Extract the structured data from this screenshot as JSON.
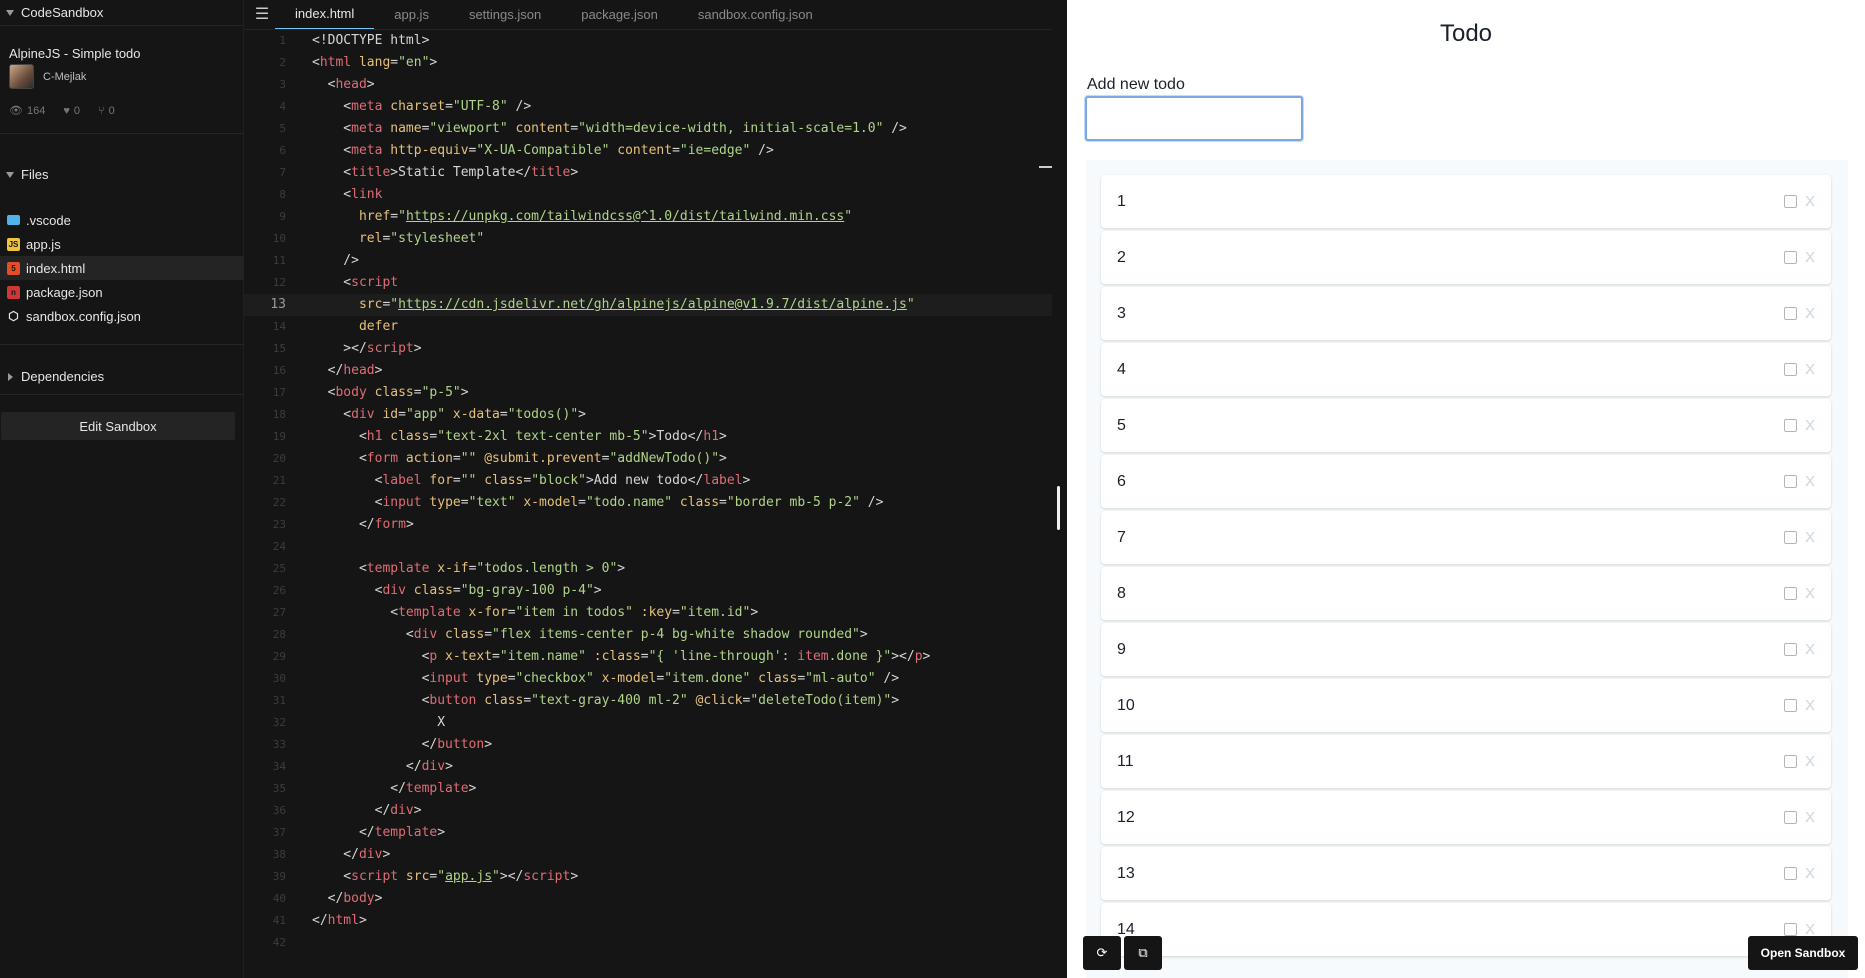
{
  "app_name": "CodeSandbox",
  "project": {
    "title": "AlpineJS - Simple todo",
    "author": "C-Mejlak",
    "views": "164",
    "likes": "0",
    "forks": "0"
  },
  "files_section": "Files",
  "files": [
    {
      "name": ".vscode",
      "icon": "folder-icon",
      "color": "#4fb3e8"
    },
    {
      "name": "app.js",
      "icon": "javascript-icon",
      "color": "#f0c33c"
    },
    {
      "name": "index.html",
      "icon": "html-icon",
      "color": "#e44d26",
      "active": true
    },
    {
      "name": "package.json",
      "icon": "npm-icon",
      "color": "#cb3837"
    },
    {
      "name": "sandbox.config.json",
      "icon": "codesandbox-cube-icon",
      "color": "#e6e6e6"
    }
  ],
  "dependencies_section": "Dependencies",
  "edit_sandbox": "Edit Sandbox",
  "tabs": [
    "index.html",
    "app.js",
    "settings.json",
    "package.json",
    "sandbox.config.json"
  ],
  "active_tab": "index.html",
  "current_line": 13,
  "code_lines": [
    [
      [
        "p",
        "<!DOCTYPE html>"
      ]
    ],
    [
      [
        "p",
        "<"
      ],
      [
        "t",
        "html"
      ],
      [
        "a",
        " lang"
      ],
      [
        "p",
        "="
      ],
      [
        "s",
        "\"en\""
      ],
      [
        "p",
        ">"
      ]
    ],
    [
      [
        "p",
        "  <"
      ],
      [
        "t",
        "head"
      ],
      [
        "p",
        ">"
      ]
    ],
    [
      [
        "p",
        "    <"
      ],
      [
        "t",
        "meta"
      ],
      [
        "a",
        " charset"
      ],
      [
        "p",
        "="
      ],
      [
        "s",
        "\"UTF-8\""
      ],
      [
        "p",
        " />"
      ]
    ],
    [
      [
        "p",
        "    <"
      ],
      [
        "t",
        "meta"
      ],
      [
        "a",
        " name"
      ],
      [
        "p",
        "="
      ],
      [
        "s",
        "\"viewport\""
      ],
      [
        "a",
        " content"
      ],
      [
        "p",
        "="
      ],
      [
        "s",
        "\"width=device-width, initial-scale=1.0\""
      ],
      [
        "p",
        " />"
      ]
    ],
    [
      [
        "p",
        "    <"
      ],
      [
        "t",
        "meta"
      ],
      [
        "a",
        " http-equiv"
      ],
      [
        "p",
        "="
      ],
      [
        "s",
        "\"X-UA-Compatible\""
      ],
      [
        "a",
        " content"
      ],
      [
        "p",
        "="
      ],
      [
        "s",
        "\"ie=edge\""
      ],
      [
        "p",
        " />"
      ]
    ],
    [
      [
        "p",
        "    <"
      ],
      [
        "t",
        "title"
      ],
      [
        "p",
        ">Static Template</"
      ],
      [
        "t",
        "title"
      ],
      [
        "p",
        ">"
      ]
    ],
    [
      [
        "p",
        "    <"
      ],
      [
        "t",
        "link"
      ]
    ],
    [
      [
        "a",
        "      href"
      ],
      [
        "p",
        "="
      ],
      [
        "s",
        "\""
      ],
      [
        "su",
        "https://unpkg.com/tailwindcss@^1.0/dist/tailwind.min.css"
      ],
      [
        "s",
        "\""
      ]
    ],
    [
      [
        "a",
        "      rel"
      ],
      [
        "p",
        "="
      ],
      [
        "s",
        "\"stylesheet\""
      ]
    ],
    [
      [
        "p",
        "    />"
      ]
    ],
    [
      [
        "p",
        "    <"
      ],
      [
        "t",
        "script"
      ]
    ],
    [
      [
        "a",
        "      src"
      ],
      [
        "p",
        "="
      ],
      [
        "s",
        "\""
      ],
      [
        "su",
        "https://cdn.jsdelivr.net/gh/alpinejs/alpine@v1.9.7/dist/alpine.js"
      ],
      [
        "s",
        "\""
      ]
    ],
    [
      [
        "a",
        "      defer"
      ]
    ],
    [
      [
        "p",
        "    ></"
      ],
      [
        "t",
        "script"
      ],
      [
        "p",
        ">"
      ]
    ],
    [
      [
        "p",
        "  </"
      ],
      [
        "t",
        "head"
      ],
      [
        "p",
        ">"
      ]
    ],
    [
      [
        "p",
        "  <"
      ],
      [
        "t",
        "body"
      ],
      [
        "a",
        " class"
      ],
      [
        "p",
        "="
      ],
      [
        "s",
        "\"p-5\""
      ],
      [
        "p",
        ">"
      ]
    ],
    [
      [
        "p",
        "    <"
      ],
      [
        "t",
        "div"
      ],
      [
        "a",
        " id"
      ],
      [
        "p",
        "="
      ],
      [
        "s",
        "\"app\""
      ],
      [
        "a",
        " x-data"
      ],
      [
        "p",
        "="
      ],
      [
        "s",
        "\"todos()\""
      ],
      [
        "p",
        ">"
      ]
    ],
    [
      [
        "p",
        "      <"
      ],
      [
        "t",
        "h1"
      ],
      [
        "a",
        " class"
      ],
      [
        "p",
        "="
      ],
      [
        "s",
        "\"text-2xl text-center mb-5\""
      ],
      [
        "p",
        ">Todo</"
      ],
      [
        "t",
        "h1"
      ],
      [
        "p",
        ">"
      ]
    ],
    [
      [
        "p",
        "      <"
      ],
      [
        "t",
        "form"
      ],
      [
        "a",
        " action"
      ],
      [
        "p",
        "="
      ],
      [
        "s",
        "\"\""
      ],
      [
        "a",
        " @submit.prevent"
      ],
      [
        "p",
        "="
      ],
      [
        "s",
        "\"addNewTodo()\""
      ],
      [
        "p",
        ">"
      ]
    ],
    [
      [
        "p",
        "        <"
      ],
      [
        "t",
        "label"
      ],
      [
        "a",
        " for"
      ],
      [
        "p",
        "="
      ],
      [
        "s",
        "\"\""
      ],
      [
        "a",
        " class"
      ],
      [
        "p",
        "="
      ],
      [
        "s",
        "\"block\""
      ],
      [
        "p",
        ">Add new todo</"
      ],
      [
        "t",
        "label"
      ],
      [
        "p",
        ">"
      ]
    ],
    [
      [
        "p",
        "        <"
      ],
      [
        "t",
        "input"
      ],
      [
        "a",
        " type"
      ],
      [
        "p",
        "="
      ],
      [
        "s",
        "\"text\""
      ],
      [
        "a",
        " x-model"
      ],
      [
        "p",
        "="
      ],
      [
        "s",
        "\"todo.name\""
      ],
      [
        "a",
        " class"
      ],
      [
        "p",
        "="
      ],
      [
        "s",
        "\"border mb-5 p-2\""
      ],
      [
        "p",
        " />"
      ]
    ],
    [
      [
        "p",
        "      </"
      ],
      [
        "t",
        "form"
      ],
      [
        "p",
        ">"
      ]
    ],
    [
      [
        "p",
        ""
      ]
    ],
    [
      [
        "p",
        "      <"
      ],
      [
        "t",
        "template"
      ],
      [
        "a",
        " x-if"
      ],
      [
        "p",
        "="
      ],
      [
        "s",
        "\"todos.length > 0\""
      ],
      [
        "p",
        ">"
      ]
    ],
    [
      [
        "p",
        "        <"
      ],
      [
        "t",
        "div"
      ],
      [
        "a",
        " class"
      ],
      [
        "p",
        "="
      ],
      [
        "s",
        "\"bg-gray-100 p-4\""
      ],
      [
        "p",
        ">"
      ]
    ],
    [
      [
        "p",
        "          <"
      ],
      [
        "t",
        "template"
      ],
      [
        "a",
        " x-for"
      ],
      [
        "p",
        "="
      ],
      [
        "s",
        "\"item in todos\""
      ],
      [
        "a",
        " :key"
      ],
      [
        "p",
        "="
      ],
      [
        "s",
        "\"item.id\""
      ],
      [
        "p",
        ">"
      ]
    ],
    [
      [
        "p",
        "            <"
      ],
      [
        "t",
        "div"
      ],
      [
        "a",
        " class"
      ],
      [
        "p",
        "="
      ],
      [
        "s",
        "\"flex items-center p-4 bg-white shadow rounded\""
      ],
      [
        "p",
        ">"
      ]
    ],
    [
      [
        "p",
        "              <"
      ],
      [
        "t",
        "p"
      ],
      [
        "a",
        " x-text"
      ],
      [
        "p",
        "="
      ],
      [
        "s",
        "\"item.name\""
      ],
      [
        "a",
        " :class"
      ],
      [
        "p",
        "="
      ],
      [
        "s",
        "\"{ 'line-through': "
      ],
      [
        "t",
        "item"
      ],
      [
        "s",
        ".done }\""
      ],
      [
        "p",
        "></"
      ],
      [
        "t",
        "p"
      ],
      [
        "p",
        ">"
      ]
    ],
    [
      [
        "p",
        "              <"
      ],
      [
        "t",
        "input"
      ],
      [
        "a",
        " type"
      ],
      [
        "p",
        "="
      ],
      [
        "s",
        "\"checkbox\""
      ],
      [
        "a",
        " x-model"
      ],
      [
        "p",
        "="
      ],
      [
        "s",
        "\"item.done\""
      ],
      [
        "a",
        " class"
      ],
      [
        "p",
        "="
      ],
      [
        "s",
        "\"ml-auto\""
      ],
      [
        "p",
        " />"
      ]
    ],
    [
      [
        "p",
        "              <"
      ],
      [
        "t",
        "button"
      ],
      [
        "a",
        " class"
      ],
      [
        "p",
        "="
      ],
      [
        "s",
        "\"text-gray-400 ml-2\""
      ],
      [
        "a",
        " @click"
      ],
      [
        "p",
        "="
      ],
      [
        "s",
        "\"deleteTodo(item)\""
      ],
      [
        "p",
        ">"
      ]
    ],
    [
      [
        "p",
        "                X"
      ]
    ],
    [
      [
        "p",
        "              </"
      ],
      [
        "t",
        "button"
      ],
      [
        "p",
        ">"
      ]
    ],
    [
      [
        "p",
        "            </"
      ],
      [
        "t",
        "div"
      ],
      [
        "p",
        ">"
      ]
    ],
    [
      [
        "p",
        "          </"
      ],
      [
        "t",
        "template"
      ],
      [
        "p",
        ">"
      ]
    ],
    [
      [
        "p",
        "        </"
      ],
      [
        "t",
        "div"
      ],
      [
        "p",
        ">"
      ]
    ],
    [
      [
        "p",
        "      </"
      ],
      [
        "t",
        "template"
      ],
      [
        "p",
        ">"
      ]
    ],
    [
      [
        "p",
        "    </"
      ],
      [
        "t",
        "div"
      ],
      [
        "p",
        ">"
      ]
    ],
    [
      [
        "p",
        "    <"
      ],
      [
        "t",
        "script"
      ],
      [
        "a",
        " src"
      ],
      [
        "p",
        "="
      ],
      [
        "s",
        "\""
      ],
      [
        "su",
        "app.js"
      ],
      [
        "s",
        "\""
      ],
      [
        "p",
        "></"
      ],
      [
        "t",
        "script"
      ],
      [
        "p",
        ">"
      ]
    ],
    [
      [
        "p",
        "  </"
      ],
      [
        "t",
        "body"
      ],
      [
        "p",
        ">"
      ]
    ],
    [
      [
        "p",
        "</"
      ],
      [
        "t",
        "html"
      ],
      [
        "p",
        ">"
      ]
    ],
    [
      [
        "p",
        ""
      ]
    ]
  ],
  "preview": {
    "title": "Todo",
    "add_label": "Add new todo",
    "input_value": "",
    "todos": [
      "1",
      "2",
      "3",
      "4",
      "5",
      "6",
      "7",
      "8",
      "9",
      "10",
      "11",
      "12",
      "13",
      "14"
    ],
    "delete_label": "X",
    "open_sandbox": "Open Sandbox"
  }
}
